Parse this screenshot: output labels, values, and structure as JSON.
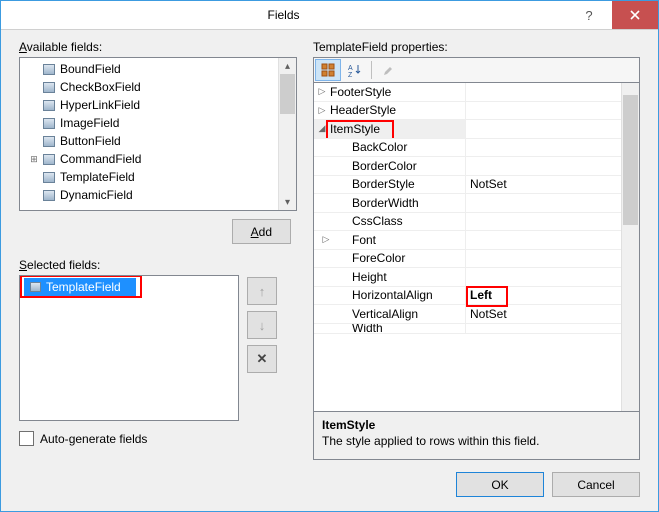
{
  "window": {
    "title": "Fields",
    "help_icon": "?",
    "close_icon": "×"
  },
  "left": {
    "available_label": "Available fields:",
    "add_btn": "Add",
    "fields": [
      {
        "name": "BoundField",
        "icon": "field-icon"
      },
      {
        "name": "CheckBoxField",
        "icon": "field-icon"
      },
      {
        "name": "HyperLinkField",
        "icon": "field-icon"
      },
      {
        "name": "ImageField",
        "icon": "field-icon"
      },
      {
        "name": "ButtonField",
        "icon": "field-icon"
      },
      {
        "name": "CommandField",
        "icon": "field-icon",
        "expandable": true
      },
      {
        "name": "TemplateField",
        "icon": "field-icon"
      },
      {
        "name": "DynamicField",
        "icon": "field-icon"
      }
    ],
    "selected_label": "Selected fields:",
    "selected": [
      {
        "name": "TemplateField",
        "icon": "field-icon"
      }
    ],
    "move_up": "↑",
    "move_down": "↓",
    "delete": "✕",
    "autogen_label": "Auto-generate fields"
  },
  "right": {
    "props_label": "TemplateField properties:",
    "toolbar": {
      "categorized": "categorized-icon",
      "alpha": "alpha-sort-icon",
      "pages": "property-pages-icon"
    },
    "rows": [
      {
        "indent": 0,
        "tri": "▷",
        "name": "FooterStyle",
        "val": ""
      },
      {
        "indent": 0,
        "tri": "▷",
        "name": "HeaderStyle",
        "val": ""
      },
      {
        "indent": 0,
        "tri": "◢",
        "name": "ItemStyle",
        "val": "",
        "header": true
      },
      {
        "indent": 1,
        "tri": "",
        "name": "BackColor",
        "val": ""
      },
      {
        "indent": 1,
        "tri": "",
        "name": "BorderColor",
        "val": ""
      },
      {
        "indent": 1,
        "tri": "",
        "name": "BorderStyle",
        "val": "NotSet"
      },
      {
        "indent": 1,
        "tri": "",
        "name": "BorderWidth",
        "val": ""
      },
      {
        "indent": 1,
        "tri": "",
        "name": "CssClass",
        "val": ""
      },
      {
        "indent": 1,
        "tri": "▷",
        "name": "Font",
        "val": ""
      },
      {
        "indent": 1,
        "tri": "",
        "name": "ForeColor",
        "val": ""
      },
      {
        "indent": 1,
        "tri": "",
        "name": "Height",
        "val": ""
      },
      {
        "indent": 1,
        "tri": "",
        "name": "HorizontalAlign",
        "val": "Left",
        "bold": true
      },
      {
        "indent": 1,
        "tri": "",
        "name": "VerticalAlign",
        "val": "NotSet"
      },
      {
        "indent": 1,
        "tri": "",
        "name": "Width",
        "val": "",
        "cut": true
      }
    ],
    "desc_title": "ItemStyle",
    "desc_text": "The style applied to rows within this field."
  },
  "buttons": {
    "ok": "OK",
    "cancel": "Cancel"
  }
}
